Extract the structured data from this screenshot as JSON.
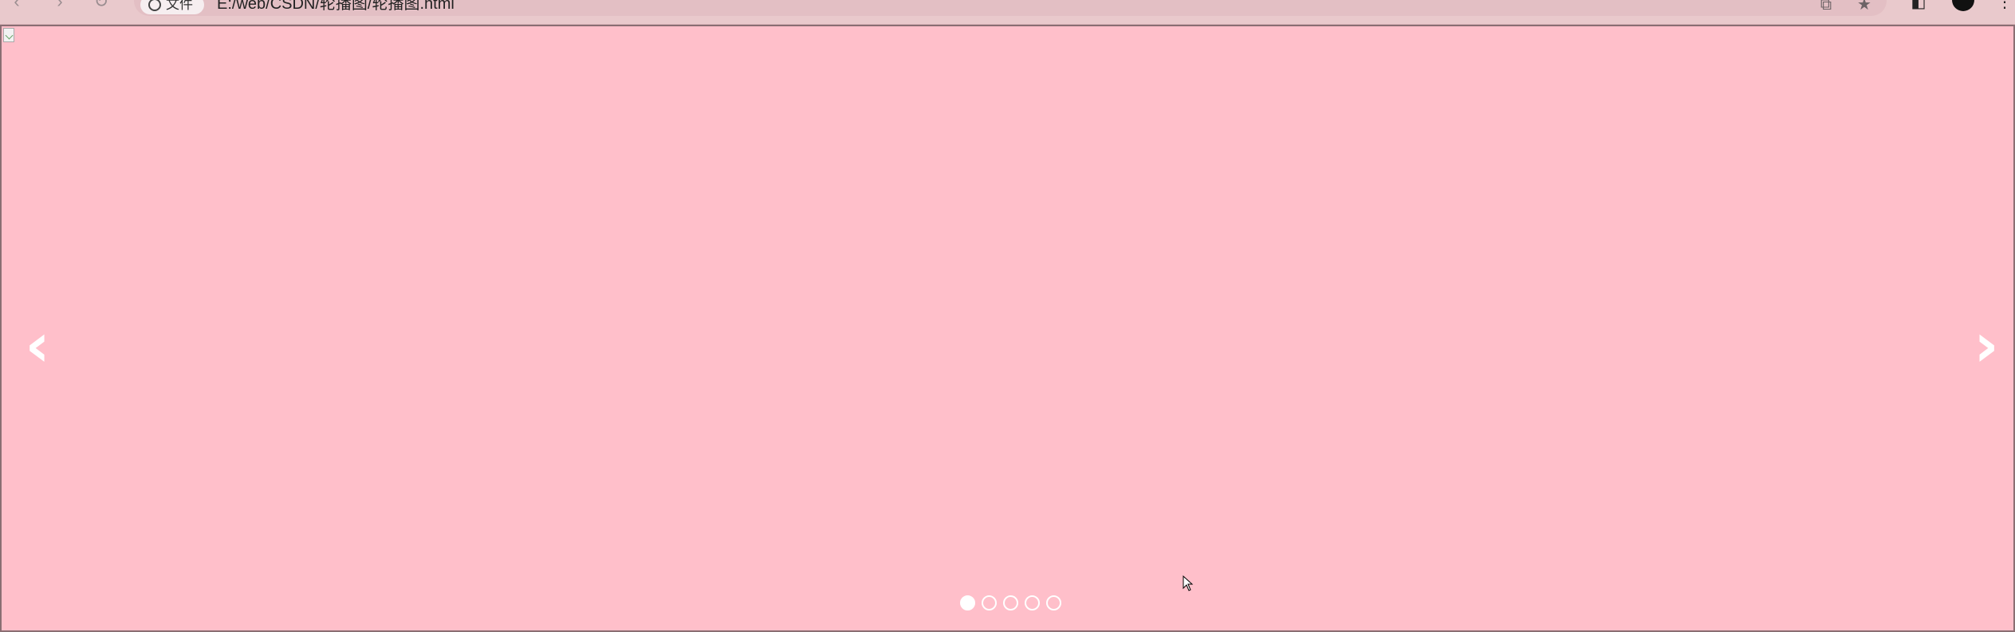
{
  "browser": {
    "site_chip_label": "文件",
    "url": "E:/web/CSDN/轮播图/轮播图.html"
  },
  "carousel": {
    "prev_arrow": "‹",
    "next_arrow": "›",
    "slide_count": 5,
    "active_index": 0,
    "background_color": "#ffbfca"
  }
}
